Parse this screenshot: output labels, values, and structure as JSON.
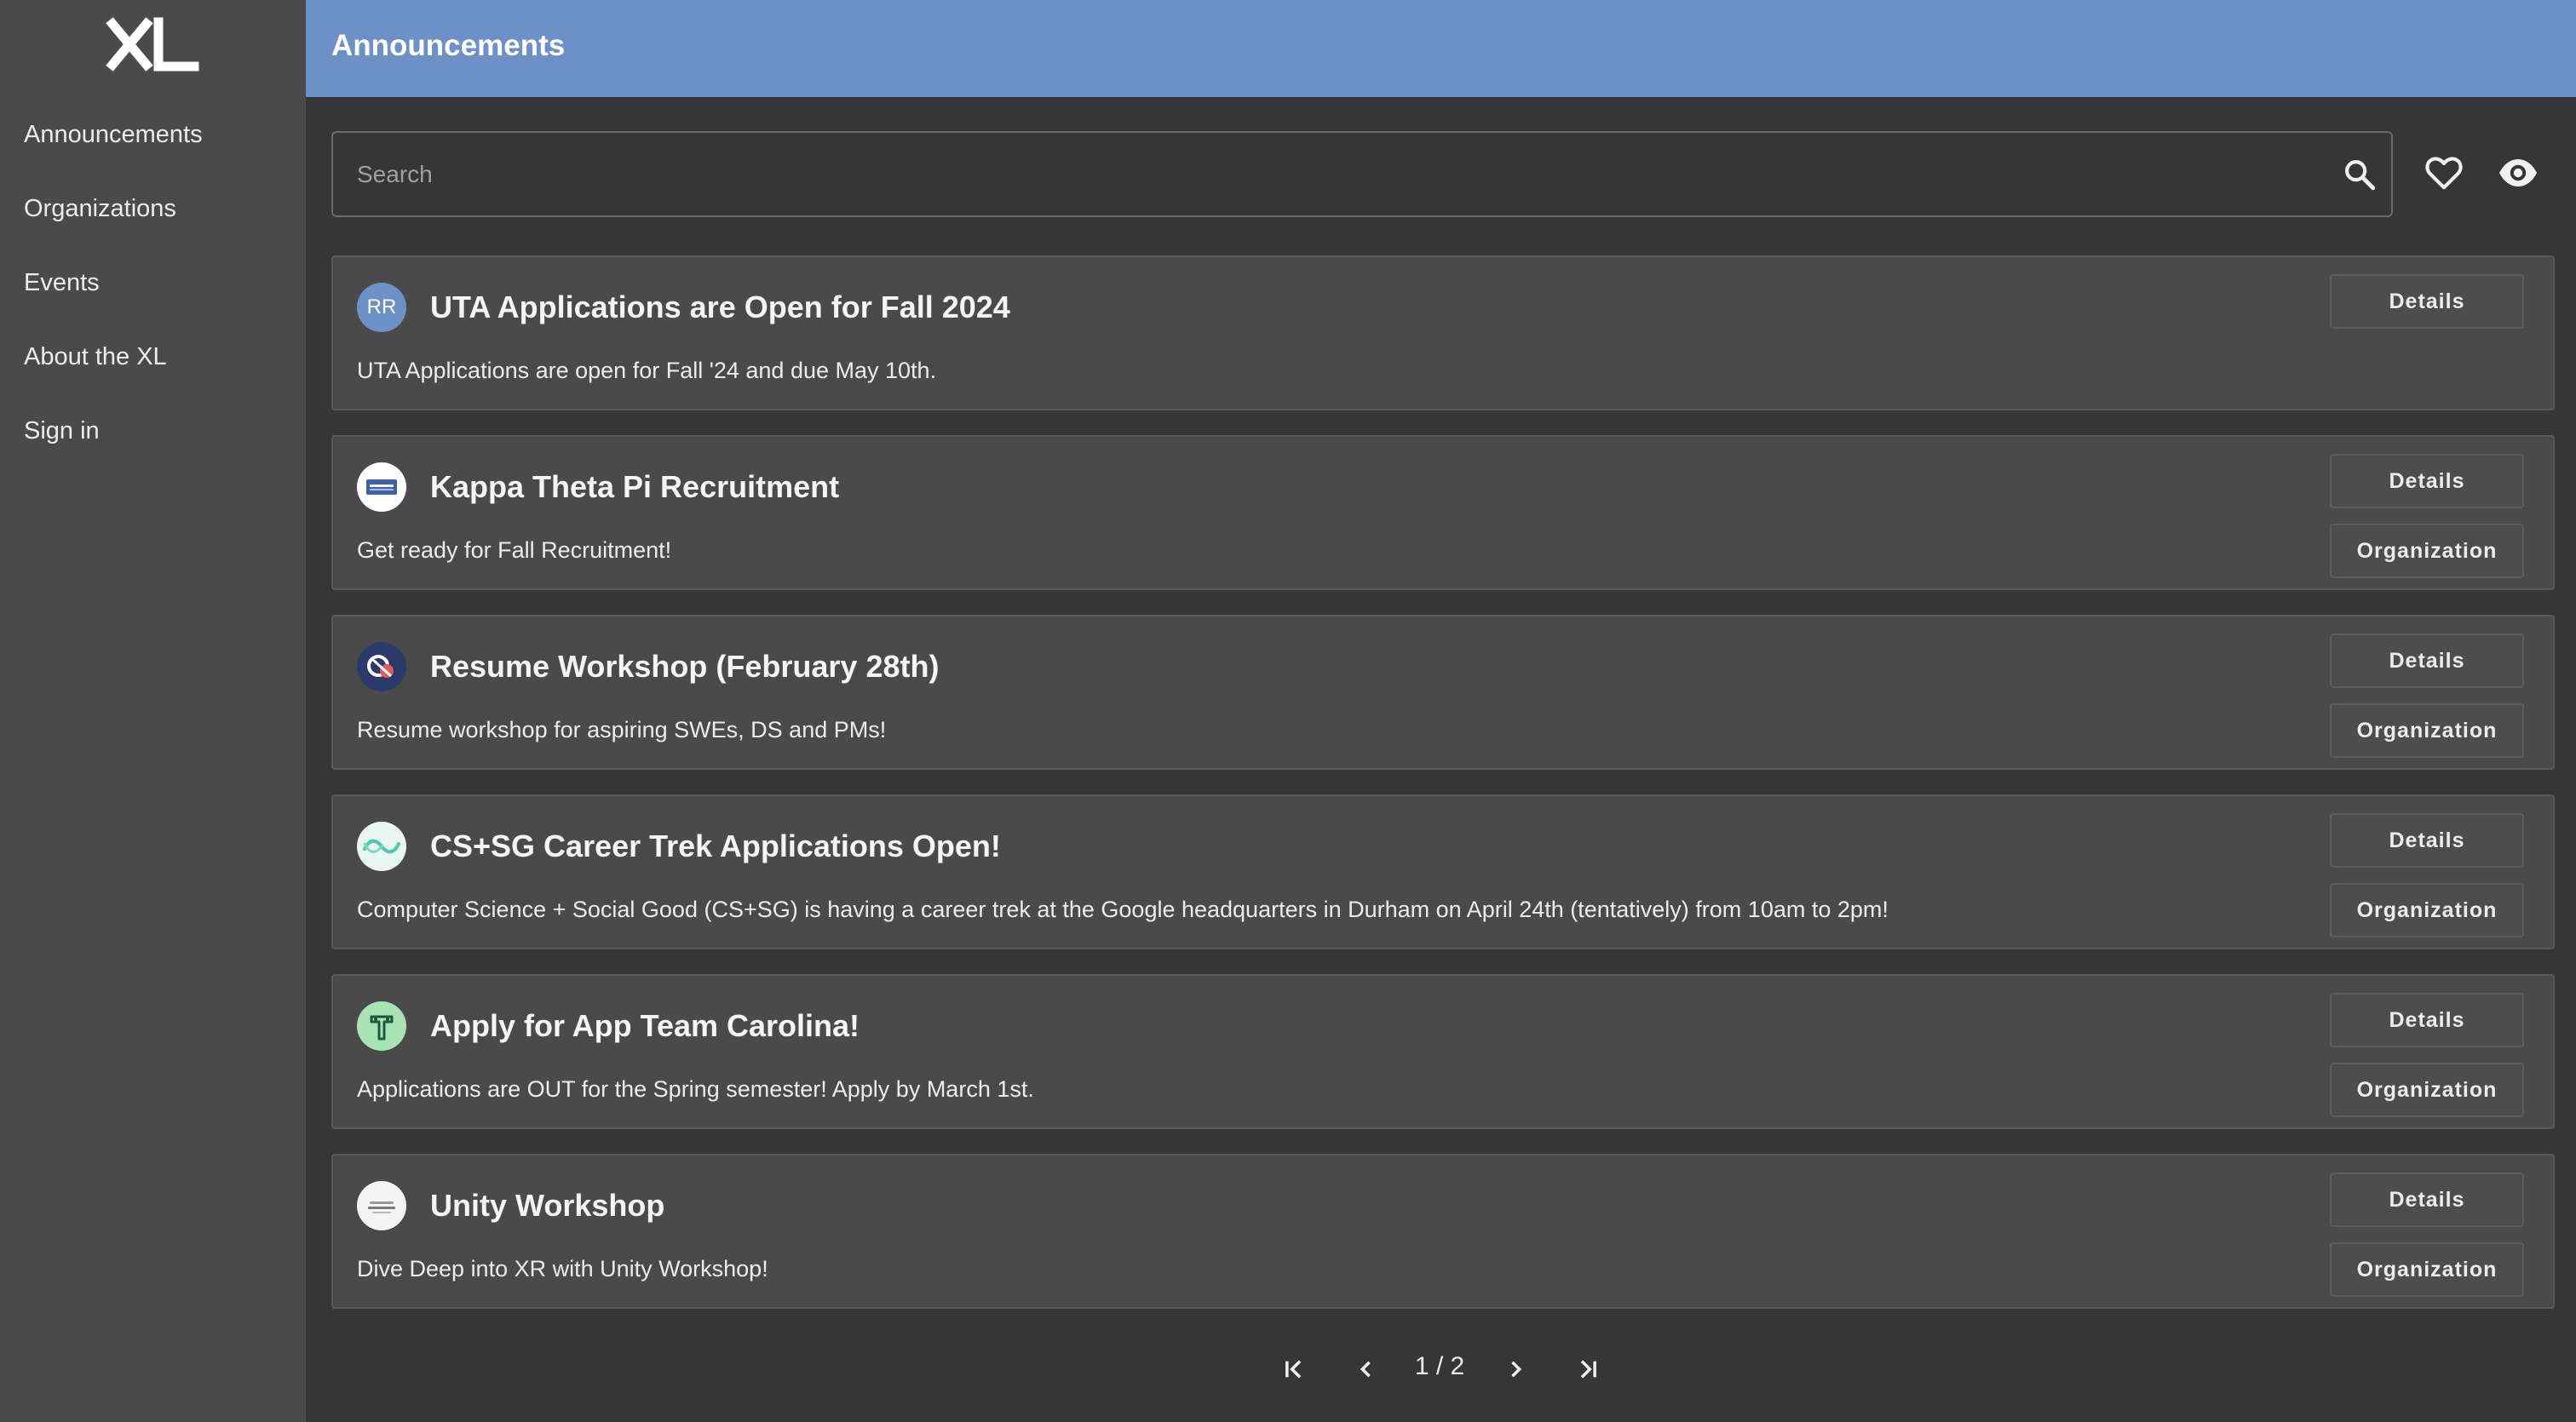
{
  "brand": {
    "logo_text": "XL"
  },
  "sidebar": {
    "items": [
      {
        "label": "Announcements"
      },
      {
        "label": "Organizations"
      },
      {
        "label": "Events"
      },
      {
        "label": "About the XL"
      },
      {
        "label": "Sign in"
      }
    ]
  },
  "header": {
    "title": "Announcements"
  },
  "search": {
    "placeholder": "Search",
    "value": ""
  },
  "buttons": {
    "details": "Details",
    "organization": "Organization"
  },
  "announcements": [
    {
      "title": "UTA Applications are Open for Fall 2024",
      "description": "UTA Applications are open for Fall '24 and due May 10th.",
      "avatar_text": "RR",
      "avatar_color": "#6d90c6",
      "has_organization": false
    },
    {
      "title": "Kappa Theta Pi Recruitment",
      "description": "Get ready for Fall Recruitment!",
      "avatar_text": "",
      "avatar_color": "#ffffff",
      "has_organization": true
    },
    {
      "title": "Resume Workshop (February 28th)",
      "description": "Resume workshop for aspiring SWEs, DS and PMs!",
      "avatar_text": "",
      "avatar_color": "#2b3a6b",
      "has_organization": true
    },
    {
      "title": "CS+SG Career Trek Applications Open!",
      "description": "Computer Science + Social Good (CS+SG) is having a career trek at the Google headquarters in Durham on April 24th (tentatively) from 10am to 2pm!",
      "avatar_text": "",
      "avatar_color": "#e8f7f1",
      "has_organization": true
    },
    {
      "title": "Apply for App Team Carolina!",
      "description": "Applications are OUT for the Spring semester! Apply by March 1st.",
      "avatar_text": "",
      "avatar_color": "#a7e3b4",
      "has_organization": true
    },
    {
      "title": "Unity Workshop",
      "description": "Dive Deep into XR with Unity Workshop!",
      "avatar_text": "",
      "avatar_color": "#f4f4f4",
      "has_organization": true
    }
  ],
  "pagination": {
    "label": "1 / 2",
    "current": 1,
    "total": 2
  },
  "colors": {
    "header": "#6d90c6",
    "sidebar": "#4a4a4a",
    "background": "#363636",
    "card": "#4a4a4a"
  }
}
